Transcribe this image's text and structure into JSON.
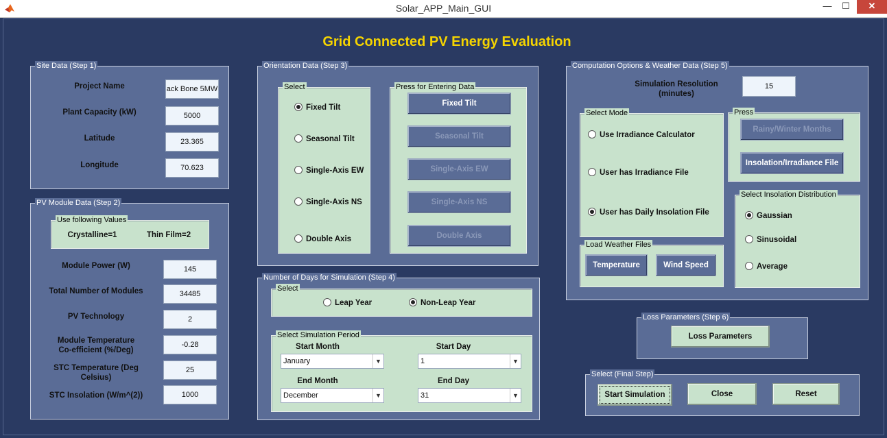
{
  "window": {
    "title": "Solar_APP_Main_GUI",
    "minimize": "—",
    "maximize": "☐",
    "close": "✕"
  },
  "heading": "Grid Connected PV Energy Evaluation",
  "site": {
    "title": "Site Data (Step 1)",
    "project_name_label": "Project Name",
    "project_name": "ack Bone 5MW",
    "capacity_label": "Plant Capacity (kW)",
    "capacity": "5000",
    "latitude_label": "Latitude",
    "latitude": "23.365",
    "longitude_label": "Longitude",
    "longitude": "70.623"
  },
  "pv": {
    "title": "PV Module Data (Step 2)",
    "values_title": "Use following Values",
    "crystalline": "Crystalline=1",
    "thinfilm": "Thin Film=2",
    "module_power_label": "Module Power (W)",
    "module_power": "145",
    "num_modules_label": "Total Number of Modules",
    "num_modules": "34485",
    "technology_label": "PV Technology",
    "technology": "2",
    "temp_coeff_label_1": "Module Temperature",
    "temp_coeff_label_2": "Co-efficient (%/Deg)",
    "temp_coeff": "-0.28",
    "stc_temp_label_1": "STC Temperature (Deg",
    "stc_temp_label_2": "Celsius)",
    "stc_temp": "25",
    "stc_insolation_label": "STC Insolation (W/m^(2))",
    "stc_insolation": "1000"
  },
  "orientation": {
    "title": "Orientation Data (Step 3)",
    "select_title": "Select",
    "press_title": "Press for Entering Data",
    "options": [
      "Fixed Tilt",
      "Seasonal Tilt",
      "Single-Axis EW",
      "Single-Axis NS",
      "Double Axis"
    ],
    "buttons": [
      "Fixed Tilt",
      "Seasonal Tilt",
      "Single-Axis EW",
      "Single-Axis NS",
      "Double Axis"
    ]
  },
  "days": {
    "title": "Number of Days for Simulation (Step 4)",
    "select_title": "Select",
    "leap": "Leap Year",
    "nonleap": "Non-Leap Year",
    "period_title": "Select Simulation Period",
    "start_month_label": "Start Month",
    "start_month": "January",
    "start_day_label": "Start Day",
    "start_day": "1",
    "end_month_label": "End Month",
    "end_month": "December",
    "end_day_label": "End Day",
    "end_day": "31"
  },
  "computation": {
    "title": "Computation Options & Weather Data (Step 5)",
    "resolution_label_1": "Simulation Resolution",
    "resolution_label_2": "(minutes)",
    "resolution": "15",
    "mode_title": "Select  Mode",
    "modes": [
      "Use Irradiance Calculator",
      "User has Irradiance File",
      "User has Daily Insolation File"
    ],
    "press_title": "Press",
    "rainy_button": "Rainy/Winter Months",
    "insolation_button": "Insolation/Irradiance File",
    "distribution_title": "Select Insolation Distribution",
    "distributions": [
      "Gaussian",
      "Sinusoidal",
      "Average"
    ],
    "weather_title": "Load Weather Files",
    "temperature_button": "Temperature",
    "wind_button": "Wind Speed"
  },
  "loss": {
    "title": "Loss Parameters (Step 6)",
    "button": "Loss Parameters"
  },
  "final": {
    "title": "Select (Final Step)",
    "start": "Start Simulation",
    "close": "Close",
    "reset": "Reset"
  }
}
